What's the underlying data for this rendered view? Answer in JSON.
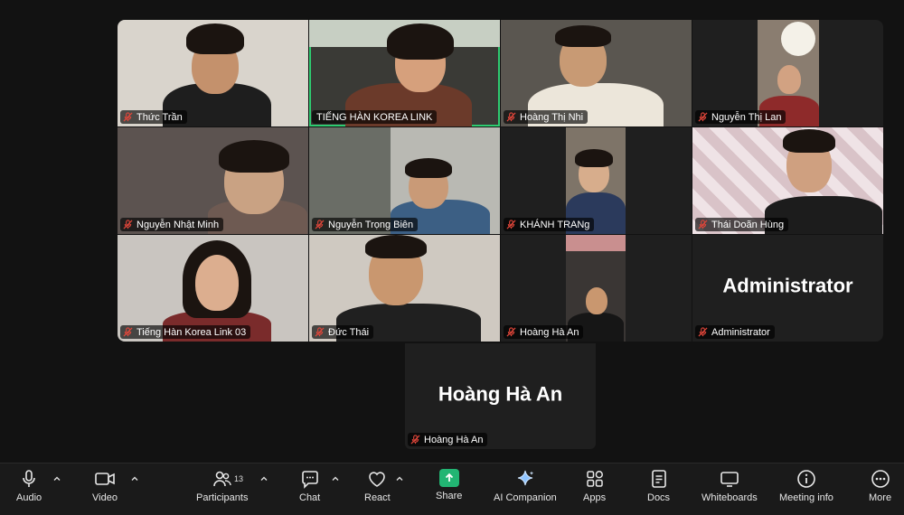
{
  "participants": [
    {
      "name": "Thức Trần",
      "muted": true
    },
    {
      "name": "TIẾNG HÀN KOREA LINK",
      "muted": false,
      "active": true
    },
    {
      "name": "Hoàng Thị Nhi",
      "muted": true
    },
    {
      "name": "Nguyễn Thị Lan",
      "muted": true
    },
    {
      "name": "Nguyễn Nhật Minh",
      "muted": true
    },
    {
      "name": "Nguyễn Trọng Biên",
      "muted": true
    },
    {
      "name": "KHÁNH TRANg",
      "muted": true
    },
    {
      "name": "Thái Doãn Hùng",
      "muted": true
    },
    {
      "name": "Tiếng Hàn Korea Link 03",
      "muted": true
    },
    {
      "name": "Đức Thái",
      "muted": true
    },
    {
      "name": "Hoàng Hà An",
      "muted": true
    },
    {
      "name": "Administrator",
      "muted": true,
      "big_label": "Administrator"
    }
  ],
  "overflow_tile": {
    "name": "Hoàng Hà An",
    "big_label": "Hoàng Hà An"
  },
  "toolbar": {
    "audio": "Audio",
    "video": "Video",
    "participants": "Participants",
    "participants_count": "13",
    "chat": "Chat",
    "react": "React",
    "share": "Share",
    "ai_companion": "AI Companion",
    "apps": "Apps",
    "docs": "Docs",
    "whiteboards": "Whiteboards",
    "meeting_info": "Meeting info",
    "more": "More"
  },
  "colors": {
    "share_accent": "#22b573",
    "active_speaker": "#2ecc71",
    "mute_red": "#e0463a"
  }
}
